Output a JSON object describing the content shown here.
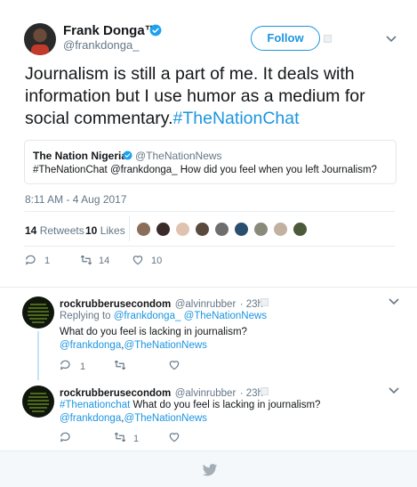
{
  "main_tweet": {
    "author": {
      "display_name": "Frank Donga™",
      "screen_name": "@frankdonga_",
      "verified": true
    },
    "follow_label": "Follow",
    "text_plain": "Journalism  is still a part of me. It deals with information but I use humor as a medium for social commentary.",
    "hashtag": "#TheNationChat",
    "quoted": {
      "name": "The Nation Nigeria",
      "handle": "@TheNationNews",
      "text": "#TheNationChat @frankdonga_ How did you feel when you left Journalism?"
    },
    "timestamp": "8:11 AM - 4 Aug 2017",
    "retweets_count": "14",
    "retweets_label": "Retweets",
    "likes_count": "10",
    "likes_label": "Likes",
    "actions": {
      "replies": "1",
      "retweets": "14",
      "likes": "10"
    }
  },
  "replies": [
    {
      "name": "rockrubberusecondom",
      "handle": "@alvinrubber",
      "time": "· 23h",
      "replying_label": "Replying to",
      "replying_to_1": "@frankdonga_",
      "replying_to_2": "@TheNationNews",
      "text": "What do you feel is lacking in journalism?",
      "mention_1": "@frankdonga",
      "mention_2": "@TheNationNews",
      "reply_count": "1",
      "retweet_count": "",
      "like_count": ""
    },
    {
      "name": "rockrubberusecondom",
      "handle": "@alvinrubber",
      "time": "· 23h",
      "hashtag": "#Thenationchat",
      "text": "What do you feel is lacking in journalism?",
      "mention_1": "@frankdonga",
      "mention_2": "@TheNationNews",
      "reply_count": "",
      "retweet_count": "1",
      "like_count": ""
    }
  ],
  "colors": {
    "link": "#1b95e0",
    "muted": "#657786",
    "text": "#14171a",
    "border": "#e6ecf0",
    "thread": "#c4e3f6"
  },
  "icons": [
    "verified-badge-icon",
    "chevron-down-icon",
    "reply-icon",
    "retweet-icon",
    "like-icon",
    "twitter-bird-icon"
  ]
}
